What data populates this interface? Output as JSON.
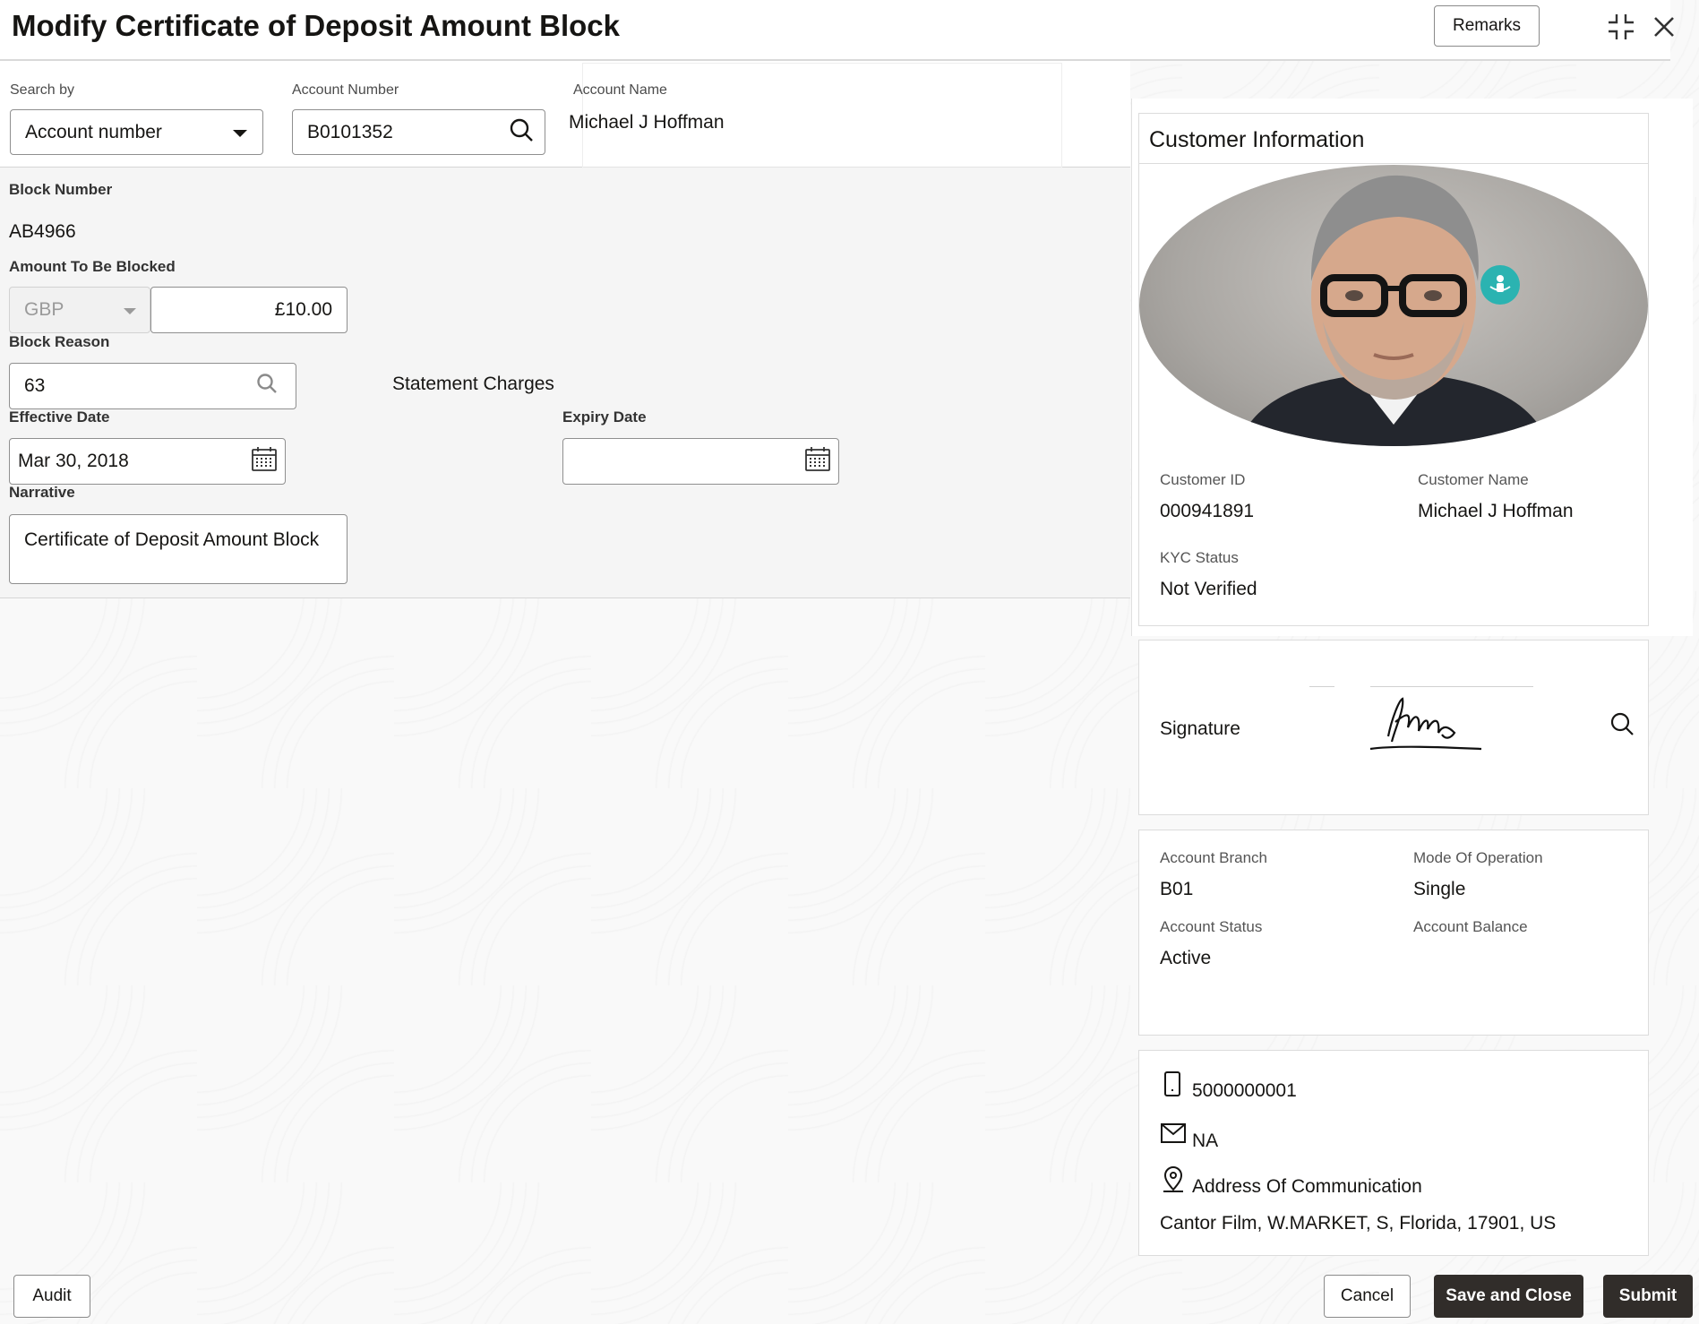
{
  "header": {
    "title": "Modify Certificate of Deposit Amount Block",
    "remarks_label": "Remarks"
  },
  "search": {
    "search_by_label": "Search by",
    "search_by_value": "Account number",
    "account_number_label": "Account Number",
    "account_number_value": "B0101352",
    "account_name_label": "Account Name",
    "account_name_value": "Michael J Hoffman"
  },
  "form": {
    "block_number_label": "Block Number",
    "block_number_value": "AB4966",
    "amount_label": "Amount To Be Blocked",
    "currency": "GBP",
    "amount_value": "£10.00",
    "block_reason_label": "Block Reason",
    "block_reason_value": "63",
    "block_reason_desc": "Statement Charges",
    "effective_date_label": "Effective Date",
    "effective_date_value": "Mar 30, 2018",
    "expiry_date_label": "Expiry Date",
    "expiry_date_value": "",
    "narrative_label": "Narrative",
    "narrative_value": "Certificate of Deposit Amount Block"
  },
  "customer": {
    "title": "Customer Information",
    "customer_id_label": "Customer ID",
    "customer_id_value": "000941891",
    "customer_name_label": "Customer Name",
    "customer_name_value": "Michael J Hoffman",
    "kyc_label": "KYC Status",
    "kyc_value": "Not Verified",
    "signature_label": "Signature",
    "account_branch_label": "Account Branch",
    "account_branch_value": "B01",
    "mode_label": "Mode Of Operation",
    "mode_value": "Single",
    "account_status_label": "Account Status",
    "account_status_value": "Active",
    "account_balance_label": "Account Balance",
    "phone": "5000000001",
    "email": "NA",
    "address_label": "Address Of Communication",
    "address_value": "Cantor Film, W.MARKET, S, Florida, 17901, US"
  },
  "footer": {
    "audit_label": "Audit",
    "cancel_label": "Cancel",
    "save_close_label": "Save and Close",
    "submit_label": "Submit"
  },
  "colors": {
    "dark_button": "#312d2a",
    "accent_teal": "#2bb3b1"
  },
  "icons": [
    "dropdown-arrow-icon",
    "search-icon",
    "calendar-icon",
    "collapse-icon",
    "close-icon",
    "phone-icon",
    "mail-icon",
    "location-icon",
    "person-badge-icon"
  ]
}
